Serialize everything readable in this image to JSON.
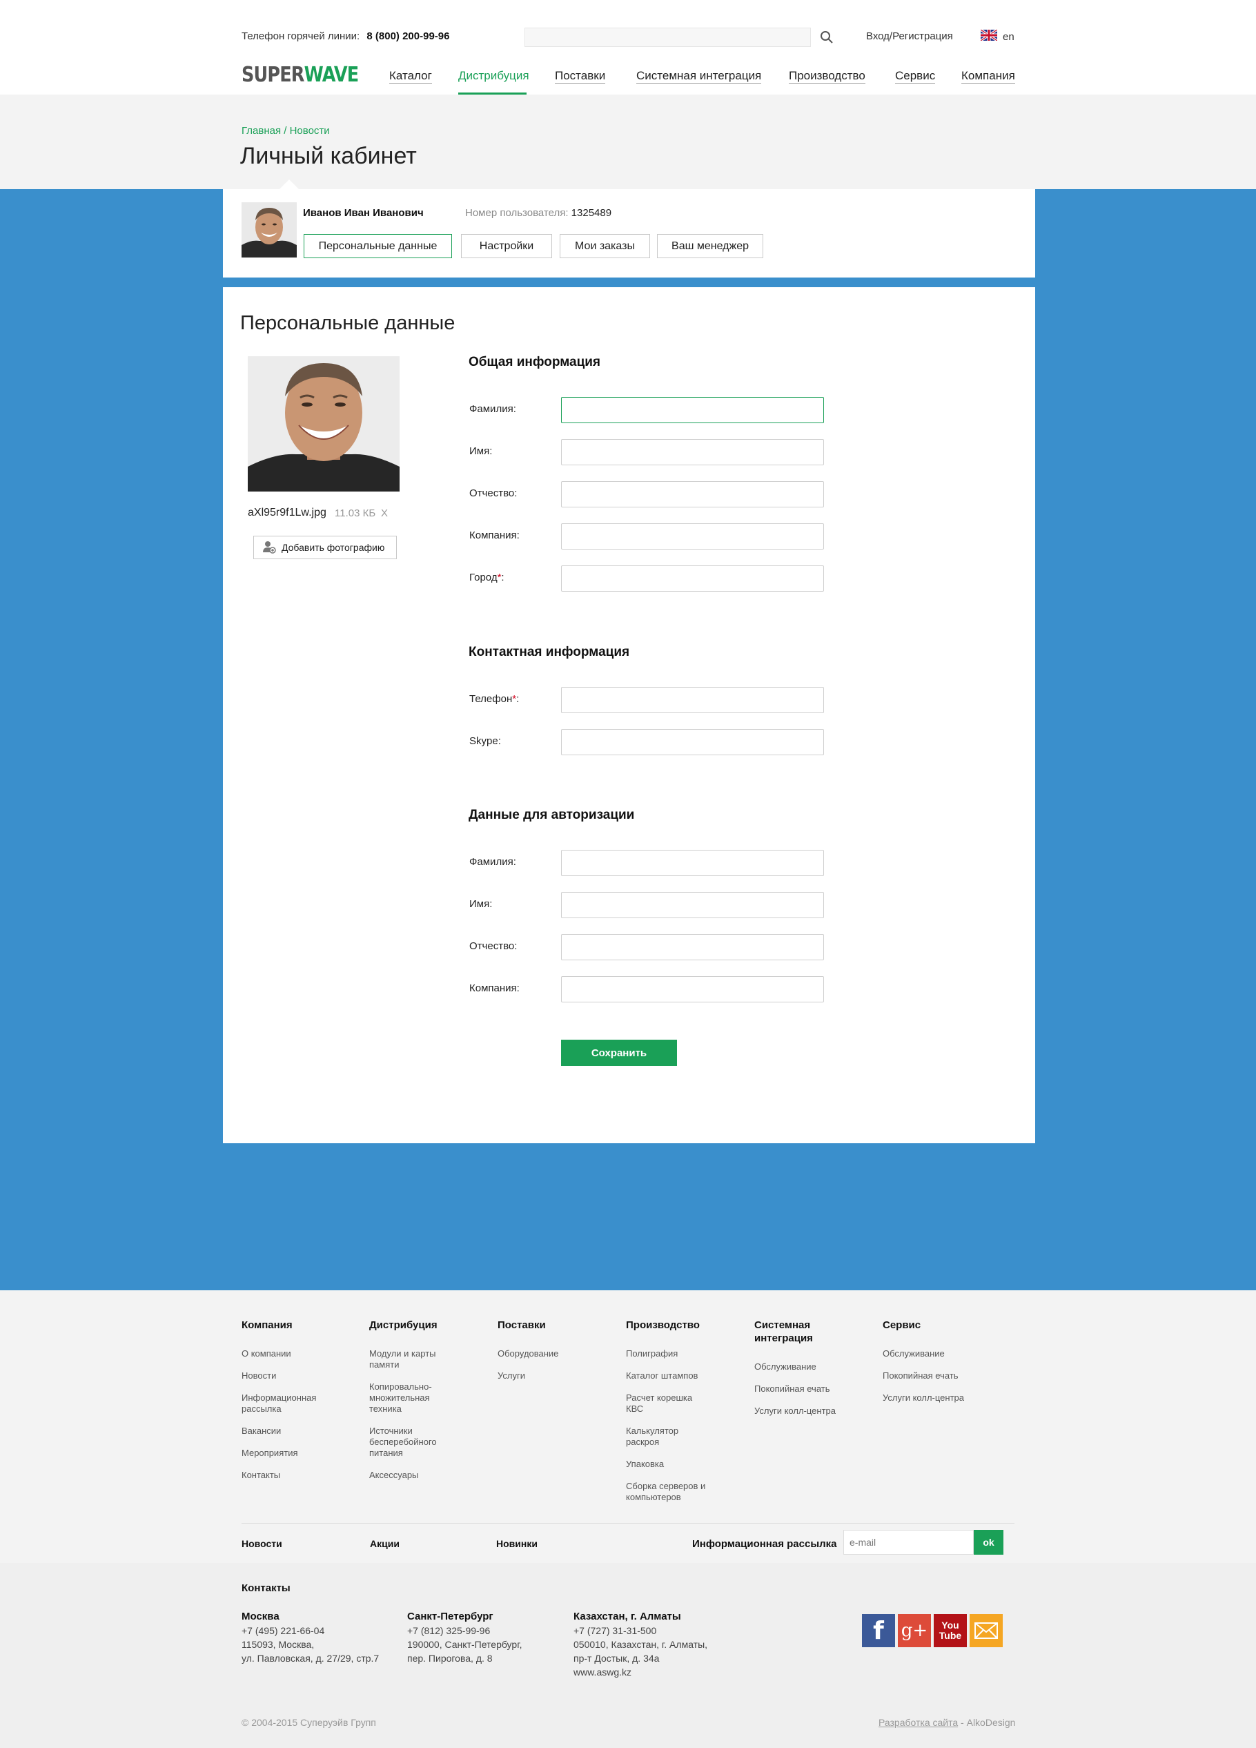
{
  "header": {
    "hotline_label": "Телефон горячей линии:",
    "hotline_phone": "8 (800) 200-99-96",
    "search_placeholder": "",
    "login_link": "Вход/Регистрация",
    "lang": "en",
    "logo_part1": "SUPER",
    "logo_part2": "WAVE"
  },
  "nav": [
    {
      "label": "Каталог"
    },
    {
      "label": "Дистрибуция",
      "active": true
    },
    {
      "label": "Поставки"
    },
    {
      "label": "Системная интеграция"
    },
    {
      "label": "Производство"
    },
    {
      "label": "Сервис"
    },
    {
      "label": "Компания"
    }
  ],
  "breadcrumb": "Главная / Новости",
  "page_title": "Личный кабинет",
  "profile": {
    "name": "Иванов Иван Иванович",
    "number_label": "Номер пользователя:",
    "number": "1325489",
    "tabs": [
      "Персональные данные",
      "Настройки",
      "Мои заказы",
      "Ваш менеджер"
    ]
  },
  "section_title": "Персональные данные",
  "photo": {
    "file_name": "aXl95r9f1Lw.jpg",
    "file_size": "11.03 КБ",
    "remove": "X",
    "add_button": "Добавить фотографию"
  },
  "form": {
    "general": {
      "title": "Общая информация",
      "fields": [
        "Фамилия:",
        "Имя:",
        "Отчество:",
        "Компания:",
        "Город"
      ]
    },
    "contact": {
      "title": "Контактная информация",
      "fields": [
        "Телефон",
        "Skype:"
      ]
    },
    "auth": {
      "title": "Данные для авторизации",
      "fields": [
        "Фамилия:",
        "Имя:",
        "Отчество:",
        "Компания:"
      ]
    },
    "required_mark": "*",
    "required_suffix": ":",
    "save_button": "Сохранить"
  },
  "footer": {
    "columns": [
      {
        "title": "Компания",
        "links": [
          "О компании",
          "Новости",
          "Информационная рассылка",
          "Вакансии",
          "Мероприятия",
          "Контакты"
        ]
      },
      {
        "title": "Дистрибуция",
        "links": [
          "Модули и карты памяти",
          "Копировально-множительная техника",
          "Источники бесперебойного питания",
          "Аксессуары"
        ]
      },
      {
        "title": "Поставки",
        "links": [
          "Оборудование",
          "Услуги"
        ]
      },
      {
        "title": "Производство",
        "links": [
          "Полиграфия",
          "Каталог штампов",
          "Расчет корешка КВС",
          "Калькулятор раскроя",
          "Упаковка",
          "Сборка серверов и компьютеров"
        ]
      },
      {
        "title": "Системная интеграция",
        "links": [
          "Обслуживание",
          "Покопийная ечать",
          "Услуги колл-центра"
        ]
      },
      {
        "title": "Сервис",
        "links": [
          "Обслуживание",
          "Покопийная ечать",
          "Услуги колл-центра"
        ]
      }
    ],
    "bottom_links": [
      "Новости",
      "Акции",
      "Новинки"
    ],
    "newsletter_label": "Информационная рассылка",
    "email_placeholder": "e-mail",
    "ok_button": "ok",
    "contacts_title": "Контакты",
    "cities": [
      {
        "name": "Москва",
        "lines": [
          "+7 (495) 221-66-04",
          "115093, Москва,",
          "ул. Павловская, д. 27/29, стр.7"
        ]
      },
      {
        "name": "Санкт-Петербург",
        "lines": [
          "+7 (812) 325-99-96",
          "190000, Санкт-Петербург,",
          "пер. Пирогова, д. 8"
        ]
      },
      {
        "name": "Казахстан, г. Алматы",
        "lines": [
          "+7 (727) 31-31-500",
          "050010, Казахстан, г. Алматы,",
          "пр-т Достык, д. 34а",
          "www.aswg.kz"
        ]
      }
    ],
    "social": {
      "facebook_glyph": "f",
      "gplus_glyph": "g+",
      "youtube_you": "You",
      "youtube_tube": "Tube"
    },
    "copyright": "© 2004-2015 Суперуэйв Групп",
    "dev_link": "Разработка сайта",
    "dev_suffix": " - AlkoDesign"
  }
}
